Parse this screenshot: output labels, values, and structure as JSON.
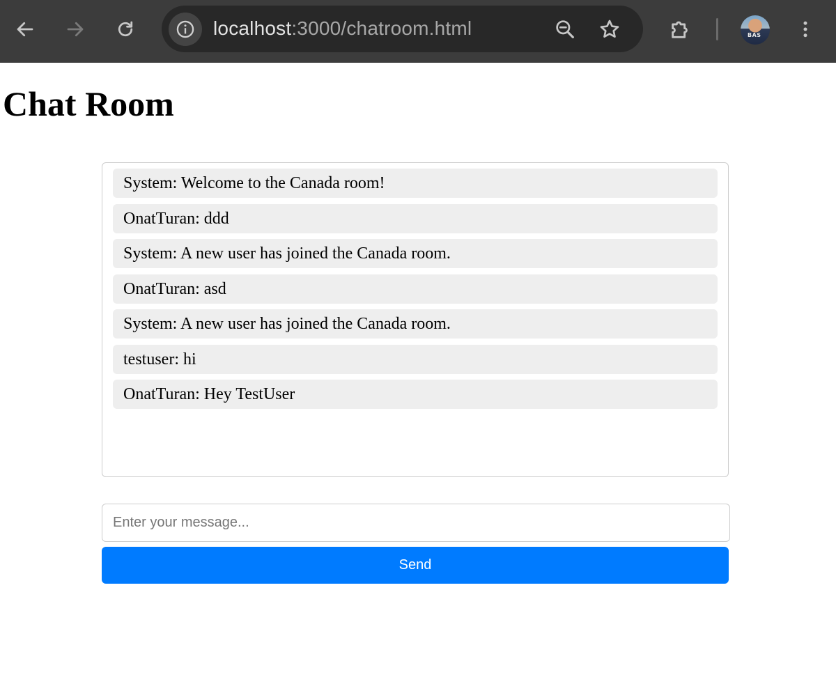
{
  "browser": {
    "url_host": "localhost",
    "url_path": ":3000/chatroom.html",
    "icons": {
      "back": "back-arrow-icon",
      "forward": "forward-arrow-icon",
      "reload": "reload-icon",
      "site_info": "info-icon",
      "zoom": "zoom-out-icon",
      "bookmark": "star-icon",
      "extensions": "puzzle-icon",
      "menu": "kebab-menu-icon"
    },
    "avatar_text": "BAS"
  },
  "page": {
    "title": "Chat Room"
  },
  "messages": [
    {
      "text": "System: Welcome to the Canada room!"
    },
    {
      "text": "OnatTuran: ddd"
    },
    {
      "text": "System: A new user has joined the Canada room."
    },
    {
      "text": "OnatTuran: asd"
    },
    {
      "text": "System: A new user has joined the Canada room."
    },
    {
      "text": "testuser: hi"
    },
    {
      "text": "OnatTuran: Hey TestUser"
    }
  ],
  "composer": {
    "value": "",
    "placeholder": "Enter your message...",
    "send_label": "Send"
  },
  "colors": {
    "accent": "#007bff",
    "message_bg": "#eeeeee",
    "toolbar_bg": "#3c3c3c"
  }
}
